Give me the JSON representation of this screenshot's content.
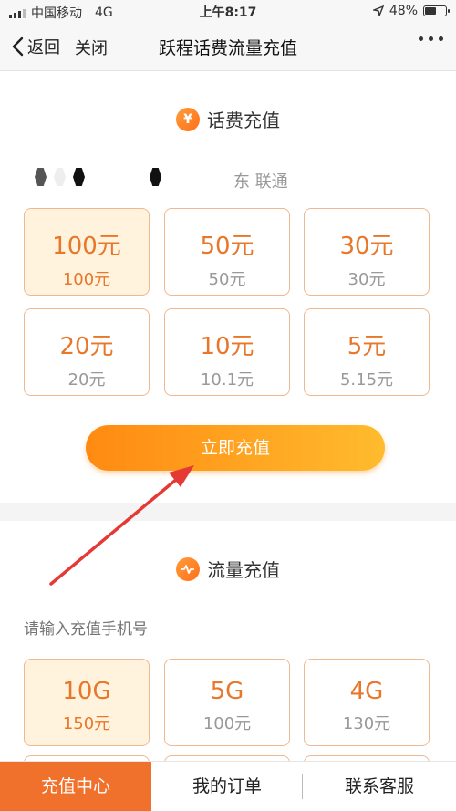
{
  "status_bar": {
    "carrier": "中国移动",
    "network": "4G",
    "time": "上午8:17",
    "battery": "48%",
    "battery_level": 0.48
  },
  "nav": {
    "back_label": "返回",
    "close_label": "关闭",
    "title": "跃程话费流量充值"
  },
  "phone_section": {
    "icon_glyph": "¥",
    "title": "话费充值",
    "carrier": "东 联通",
    "options": [
      {
        "amount": "100元",
        "price": "100元",
        "selected": true
      },
      {
        "amount": "50元",
        "price": "50元"
      },
      {
        "amount": "30元",
        "price": "30元"
      },
      {
        "amount": "20元",
        "price": "20元"
      },
      {
        "amount": "10元",
        "price": "10.1元"
      },
      {
        "amount": "5元",
        "price": "5.15元"
      }
    ],
    "recharge_button": "立即充值"
  },
  "data_section": {
    "title": "流量充值",
    "phone_placeholder": "请输入充值手机号",
    "options": [
      {
        "amount": "10G",
        "price": "150元",
        "selected": true
      },
      {
        "amount": "5G",
        "price": "100元"
      },
      {
        "amount": "4G",
        "price": "130元"
      }
    ]
  },
  "tabbar": {
    "tabs": [
      "充值中心",
      "我的订单",
      "联系客服"
    ]
  },
  "colors": {
    "accent": "#f0712b",
    "tile_border": "#f0b88f",
    "tile_selected_bg": "#fff3de",
    "amount_text": "#e8772a",
    "annotation_arrow": "#e53935"
  }
}
